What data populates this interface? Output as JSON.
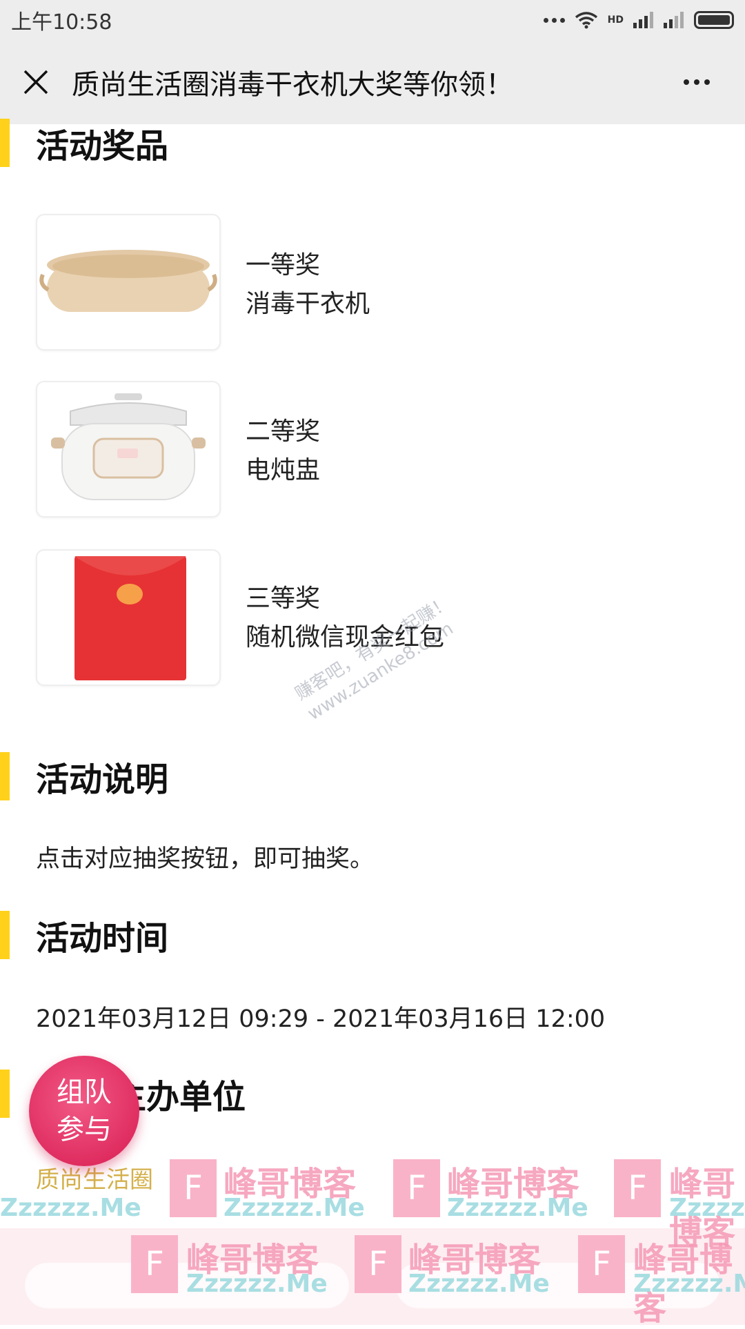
{
  "status_bar": {
    "time": "上午10:58",
    "hd_label": "HD"
  },
  "header": {
    "title": "质尚生活圈消毒干衣机大奖等你领！"
  },
  "sections": {
    "prizes_title": "活动奖品",
    "description_title": "活动说明",
    "time_title": "活动时间",
    "organizer_title": "主办单位"
  },
  "prizes": [
    {
      "level": "一等奖",
      "name": "消毒干衣机",
      "image": "sterilizing-dryer"
    },
    {
      "level": "二等奖",
      "name": "电炖盅",
      "image": "electric-stew-pot"
    },
    {
      "level": "三等奖",
      "name": "随机微信现金红包",
      "image": "red-envelope"
    }
  ],
  "description": "点击对应抽奖按钮，即可抽奖。",
  "activity_time": "2021年03月12日 09:29 - 2021年03月16日 12:00",
  "team_button": {
    "line1": "组队",
    "line2": "参与"
  },
  "organizer": "质尚生活圈",
  "watermark": {
    "cn": "峰哥博客",
    "en": "Zzzzzz.Me",
    "logo_letter": "F",
    "diag_line1": "赚客吧，有奖一起赚！",
    "diag_line2": "www.zuanke8.com"
  },
  "colors": {
    "accent_bar": "#ffd11a",
    "team_button": "#e02a5c",
    "organizer_text": "#d4b04c"
  }
}
